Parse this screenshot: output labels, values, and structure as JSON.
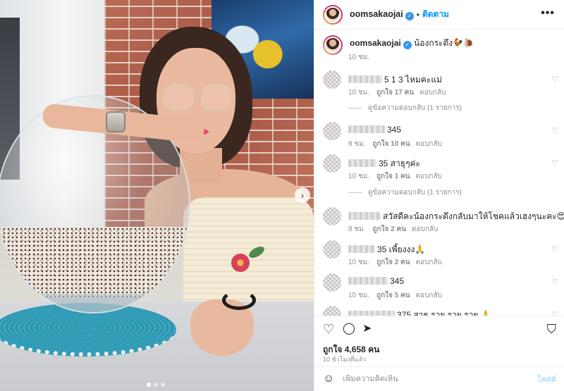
{
  "post": {
    "username": "oomsakaojai",
    "verified_mark": "✓",
    "separator": "•",
    "follow_label": "ติดตาม",
    "more_label": "•••",
    "caption_text": "น้องกระดึง🐓🐌",
    "caption_time": "10 ชม.",
    "likes_text": "ถูกใจ 4,658 คน",
    "posted_ago": "10 ชั่วโมงที่แล้ว",
    "add_comment_placeholder": "เพิ่มความคิดเห็น",
    "post_label": "โพสต์",
    "next_icon": "›"
  },
  "comments": [
    {
      "text": "5 1 3 ไหมคะแม่",
      "time": "10 ชม.",
      "likes": "ถูกใจ 17 คน",
      "reply": "ตอบกลับ"
    },
    {
      "text": "345",
      "time": "9 ชม.",
      "likes": "ถูกใจ 10 คน",
      "reply": "ตอบกลับ"
    },
    {
      "text": "35 สาธุๆค่ะ",
      "time": "10 ชม.",
      "likes": "ถูกใจ 1 คน",
      "reply": "ตอบกลับ"
    },
    {
      "text": "สวัสดีคะน้องกระดึงกลับมาให้โชคแล้วเฮงๆนะคะ😍",
      "time": "8 ชม.",
      "likes": "ถูกใจ 2 คน",
      "reply": "ตอบกลับ"
    },
    {
      "text": "35 เพี้ยงงง🙏",
      "time": "10 ชม.",
      "likes": "ถูกใจ 2 คน",
      "reply": "ตอบกลับ"
    },
    {
      "text": "345",
      "time": "10 ชม.",
      "likes": "ถูกใจ 5 คน",
      "reply": "ตอบกลับ"
    },
    {
      "text": "375 สาธุ รวย รวย รวย 🙏",
      "time": "",
      "likes": "",
      "reply": ""
    }
  ],
  "view_replies": [
    "ดูข้อความตอบกลับ (1 รายการ)",
    "ดูข้อความตอบกลับ (1 รายการ)"
  ],
  "icons": {
    "heart": "♡",
    "comment": "◯",
    "share": "➤",
    "save": "⛉",
    "emoji": "☺"
  }
}
